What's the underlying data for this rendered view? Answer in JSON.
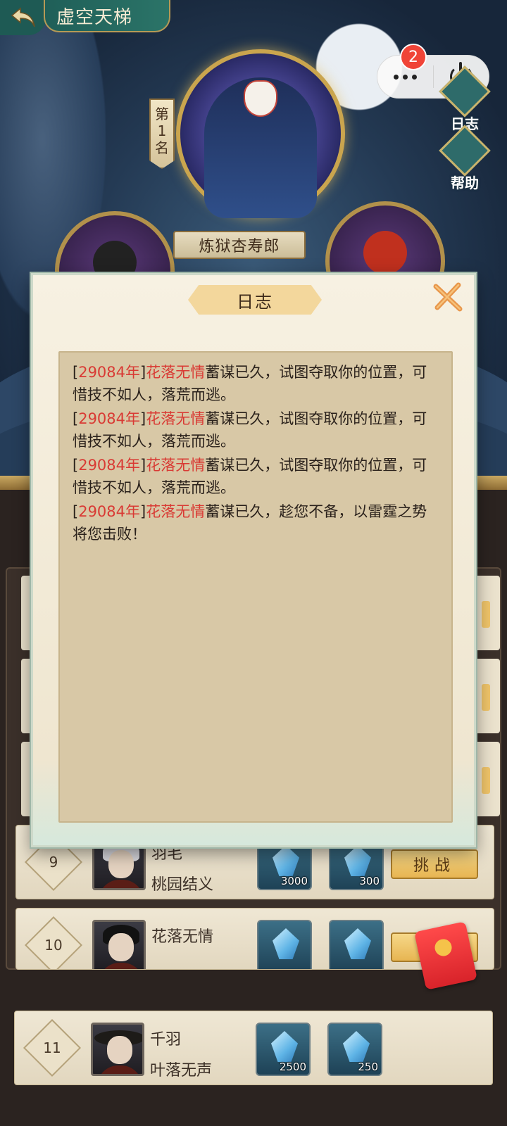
{
  "header": {
    "title": "虚空天梯",
    "badge_count": "2"
  },
  "side_buttons": {
    "log": "日志",
    "help": "帮助"
  },
  "champion": {
    "rank_label": "第1名",
    "name": "炼狱杏寿郎"
  },
  "modal": {
    "title": "日志",
    "entries": [
      {
        "open": "[",
        "year": "29084年",
        "close": "]",
        "who": "花落无情",
        "text": "蓄谋已久，试图夺取你的位置，可惜技不如人，落荒而逃。"
      },
      {
        "open": "[",
        "year": "29084年",
        "close": "]",
        "who": "花落无情",
        "text": "蓄谋已久，试图夺取你的位置，可惜技不如人，落荒而逃。"
      },
      {
        "open": "[",
        "year": "29084年",
        "close": "]",
        "who": "花落无情",
        "text": "蓄谋已久，试图夺取你的位置，可惜技不如人，落荒而逃。"
      },
      {
        "open": "[",
        "year": "29084年",
        "close": "]",
        "who": "花落无情",
        "text": "蓄谋已久，趁您不备，以雷霆之势将您击败！"
      }
    ]
  },
  "rows": [
    {
      "rank": "9",
      "name": "羽毛",
      "guild": "桃园结义",
      "reward1": "3000",
      "reward2": "300",
      "button": "挑战"
    },
    {
      "rank": "10",
      "name": "花落无情",
      "guild": "",
      "reward1": "",
      "reward2": "",
      "button": "挑"
    },
    {
      "rank": "11",
      "name": "千羽",
      "guild": "叶落无声",
      "reward1": "2500",
      "reward2": "250"
    }
  ]
}
